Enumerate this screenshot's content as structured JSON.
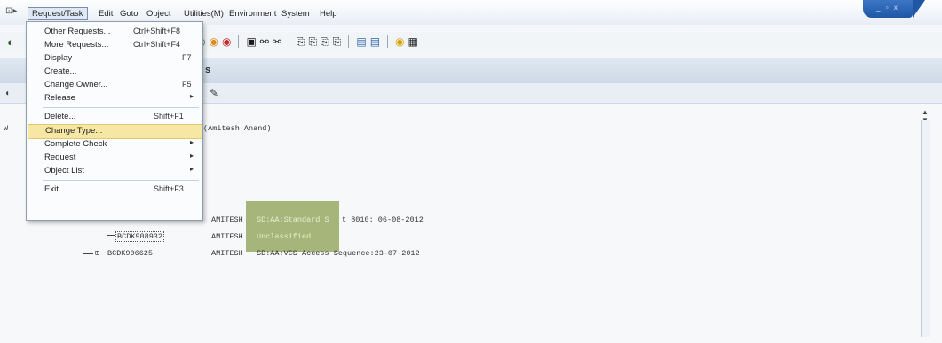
{
  "menubar": {
    "items": [
      "Request/Task",
      "Edit",
      "Goto",
      "Object",
      "Utilities(M)",
      "Environment",
      "System",
      "Help"
    ],
    "active": "Request/Task",
    "window_controls": "_ ▫ x"
  },
  "toolbar": {
    "icons": [
      "back-icon",
      "exit-icon",
      "cancel-icon",
      "print-icon",
      "find-icon",
      "find-next-icon",
      "first-page-icon",
      "prev-page-icon",
      "next-page-icon",
      "last-page-icon",
      "create-session-icon",
      "shortcut-icon",
      "help-icon",
      "layout-icon"
    ]
  },
  "title": {
    "fragment": "s"
  },
  "dropdown": {
    "groups": [
      [
        {
          "label": "Other Requests...",
          "shortcut": "Ctrl+Shift+F8"
        },
        {
          "label": "More Requests...",
          "shortcut": "Ctrl+Shift+F4"
        },
        {
          "label": "Display",
          "shortcut": "F7"
        },
        {
          "label": "Create...",
          "shortcut": ""
        },
        {
          "label": "Change Owner...",
          "shortcut": "F5"
        },
        {
          "label": "Release",
          "submenu": true
        }
      ],
      [
        {
          "label": "Delete...",
          "shortcut": "Shift+F1"
        },
        {
          "label": "Change Type...",
          "shortcut": "",
          "highlighted": true
        },
        {
          "label": "Complete Check",
          "submenu": true
        },
        {
          "label": "Request",
          "submenu": true
        },
        {
          "label": "Object List",
          "submenu": true
        }
      ],
      [
        {
          "label": "Exit",
          "shortcut": "Shift+F3"
        }
      ]
    ]
  },
  "content": {
    "owner_line": "(Amitesh Anand)",
    "left_fragment": "W",
    "rows": [
      {
        "owner": "AMITESH",
        "text_left": "SD:AA:Standard S",
        "text_right": "t 8010: 06-08-2012"
      },
      {
        "request": "BCDK908932",
        "owner": "AMITESH",
        "text": "Unclassified"
      },
      {
        "request": "BCDK906625",
        "owner": "AMITESH",
        "text": "SD:AA:VCS Access Sequence:23-07-2012",
        "prefix": "⊞"
      }
    ]
  }
}
